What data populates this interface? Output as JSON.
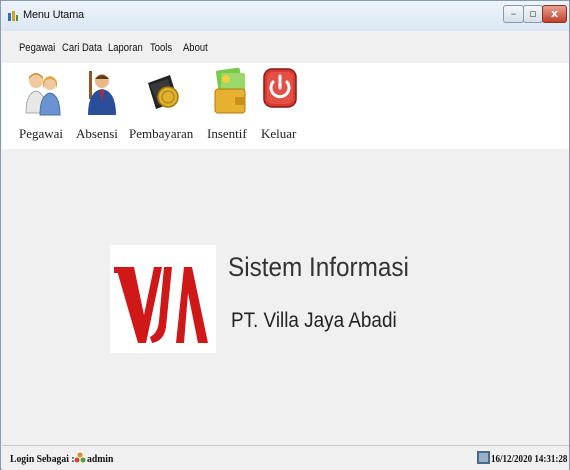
{
  "window": {
    "title": "Menu Utama",
    "close_glyph": "x",
    "min_glyph": "–",
    "max_glyph": "▫"
  },
  "menu": [
    "Pegawai",
    "Cari Data",
    "Laporan",
    "Tools",
    "About"
  ],
  "toolbar": [
    {
      "label": "Pegawai",
      "icon": "users-icon"
    },
    {
      "label": "Absensi",
      "icon": "employee-icon"
    },
    {
      "label": "Pembayaran",
      "icon": "wallet-coin-icon"
    },
    {
      "label": "Insentif",
      "icon": "money-wallet-icon"
    },
    {
      "label": "Keluar",
      "icon": "power-icon"
    }
  ],
  "main": {
    "heading": "Sistem Informasi",
    "subheading": "PT. Villa Jaya Abadi",
    "logo_text": "VJA"
  },
  "status": {
    "login_label": "Login Sebagai :",
    "user": "admin",
    "datetime": "16/12/2020 14:31:28"
  },
  "colors": {
    "logo_red": "#d01818",
    "power_red": "#d63a30"
  }
}
